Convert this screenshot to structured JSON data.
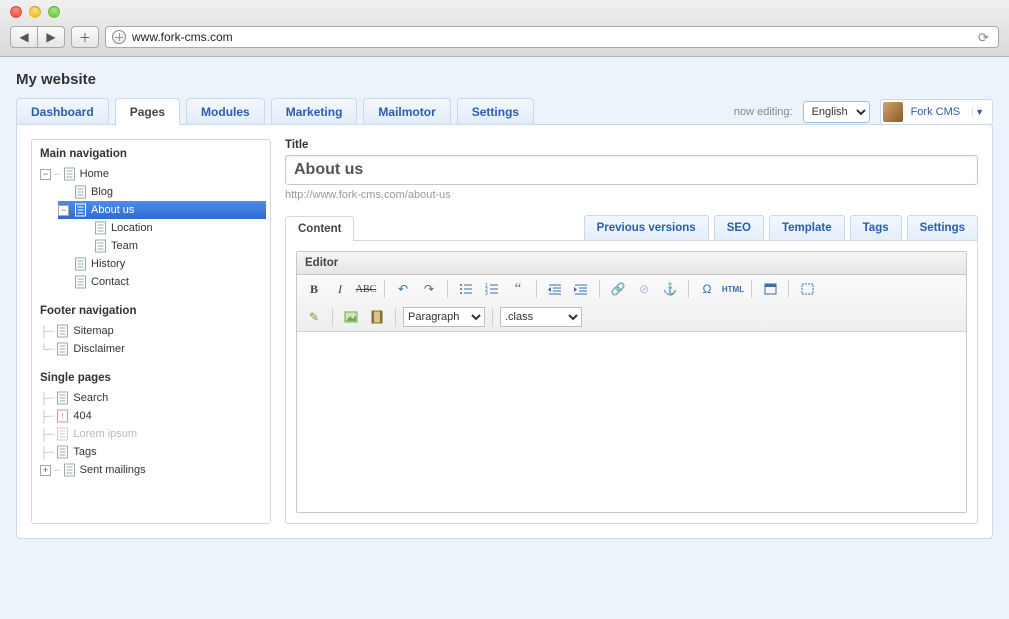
{
  "browser": {
    "url": "www.fork-cms.com"
  },
  "site": {
    "title": "My website"
  },
  "main_tabs": {
    "dashboard": "Dashboard",
    "pages": "Pages",
    "modules": "Modules",
    "marketing": "Marketing",
    "mailmotor": "Mailmotor",
    "settings": "Settings"
  },
  "top_right": {
    "now_editing": "now editing:",
    "language": "English",
    "user": "Fork CMS"
  },
  "sidebar": {
    "main_heading": "Main navigation",
    "home": "Home",
    "blog": "Blog",
    "about_us": "About us",
    "location": "Location",
    "team": "Team",
    "history": "History",
    "contact": "Contact",
    "footer_heading": "Footer navigation",
    "sitemap": "Sitemap",
    "disclaimer": "Disclaimer",
    "single_heading": "Single pages",
    "search": "Search",
    "four04": "404",
    "lorem": "Lorem ipsum",
    "tags": "Tags",
    "sent_mailings": "Sent mailings"
  },
  "editor": {
    "title_label": "Title",
    "title_value": "About us",
    "url_hint": "http://www.fork-cms.com/about-us",
    "tabs": {
      "content": "Content",
      "previous": "Previous versions",
      "seo": "SEO",
      "template": "Template",
      "tags": "Tags",
      "settings": "Settings"
    },
    "panel_title": "Editor",
    "format_select": "Paragraph",
    "class_select": ".class"
  },
  "colors": {
    "link": "#2a5db0",
    "sel_bg_top": "#4f8de8",
    "sel_bg_bottom": "#2f6ad0"
  }
}
